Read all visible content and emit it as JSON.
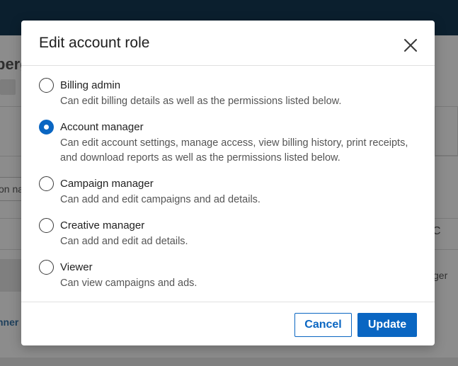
{
  "background": {
    "heading_fragment": "berg",
    "input_fragment": "on na",
    "column_fragment": "C",
    "row_fragment": "ger",
    "link_fragment": "nner"
  },
  "modal": {
    "title": "Edit account role",
    "close_icon": "close-icon",
    "options": [
      {
        "label": "Billing admin",
        "description": "Can edit billing details as well as the permissions listed below.",
        "checked": false
      },
      {
        "label": "Account manager",
        "description": "Can edit account settings, manage access, view billing history, print receipts, and download reports as well as the permissions listed below.",
        "checked": true
      },
      {
        "label": "Campaign manager",
        "description": "Can add and edit campaigns and ad details.",
        "checked": false
      },
      {
        "label": "Creative manager",
        "description": "Can add and edit ad details.",
        "checked": false
      },
      {
        "label": "Viewer",
        "description": "Can view campaigns and ads.",
        "checked": false
      }
    ],
    "cancel_label": "Cancel",
    "update_label": "Update"
  },
  "colors": {
    "accent": "#0a66c2",
    "topbar": "#0b1f2e",
    "overlay": "#8c8c8c"
  }
}
